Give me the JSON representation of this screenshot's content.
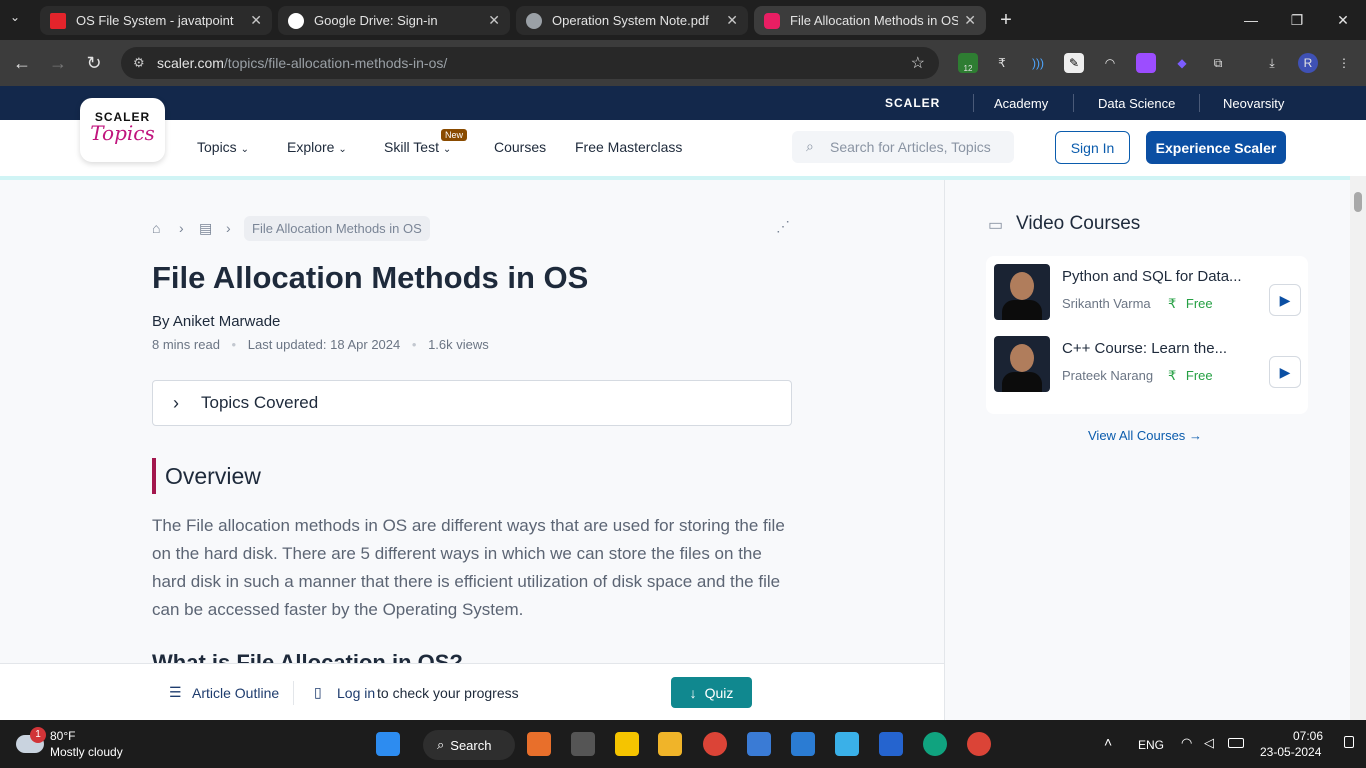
{
  "browser": {
    "tabs": [
      {
        "title": "OS File System - javatpoint",
        "icon_color": "#e3242b"
      },
      {
        "title": "Google Drive: Sign-in",
        "icon_color": "#ffffff"
      },
      {
        "title": "Operation System Note.pdf",
        "icon_color": "#9aa0a6"
      },
      {
        "title": "File Allocation Methods in OS -",
        "icon_color": "#e91e63"
      }
    ],
    "url_domain": "scaler.com",
    "url_path": "/topics/file-allocation-methods-in-os/",
    "extension_badge": "12"
  },
  "site": {
    "top_links": [
      "SCALER",
      "Academy",
      "Data Science",
      "Neovarsity"
    ],
    "logo_line1": "SCALER",
    "logo_line2": "Topics",
    "nav": [
      "Topics",
      "Explore",
      "Skill Test",
      "Courses",
      "Free Masterclass"
    ],
    "new_badge": "New",
    "search_placeholder": "Search for Articles, Topics",
    "sign_in": "Sign In",
    "experience": "Experience Scaler"
  },
  "article": {
    "breadcrumb_current": "File Allocation Methods in OS",
    "title": "File Allocation Methods in OS",
    "author": "By Aniket Marwade",
    "read_time": "8 mins read",
    "updated": "Last updated: 18 Apr 2024",
    "views": "1.6k views",
    "topics_covered": "Topics Covered",
    "overview_heading": "Overview",
    "overview_text": "The File allocation methods in OS are different ways that are used for storing the file on the hard disk. There are 5 different ways in which we can store the files on the hard disk in such a manner that there is efficient utilization of disk space and the file can be accessed faster by the Operating System.",
    "next_heading": "What is File Allocation in OS?"
  },
  "bottom_bar": {
    "outline": "Article Outline",
    "login": "Log in",
    "progress": "to check your progress",
    "quiz": "Quiz"
  },
  "sidebar": {
    "title": "Video Courses",
    "courses": [
      {
        "title": "Python and SQL for Data...",
        "author": "Srikanth Varma",
        "price": "Free"
      },
      {
        "title": "C++ Course: Learn the...",
        "author": "Prateek Narang",
        "price": "Free"
      }
    ],
    "view_all": "View All Courses"
  },
  "taskbar": {
    "weather_temp": "80°F",
    "weather_desc": "Mostly cloudy",
    "weather_badge": "1",
    "search": "Search",
    "lang": "ENG",
    "time": "07:06",
    "date": "23-05-2024"
  }
}
